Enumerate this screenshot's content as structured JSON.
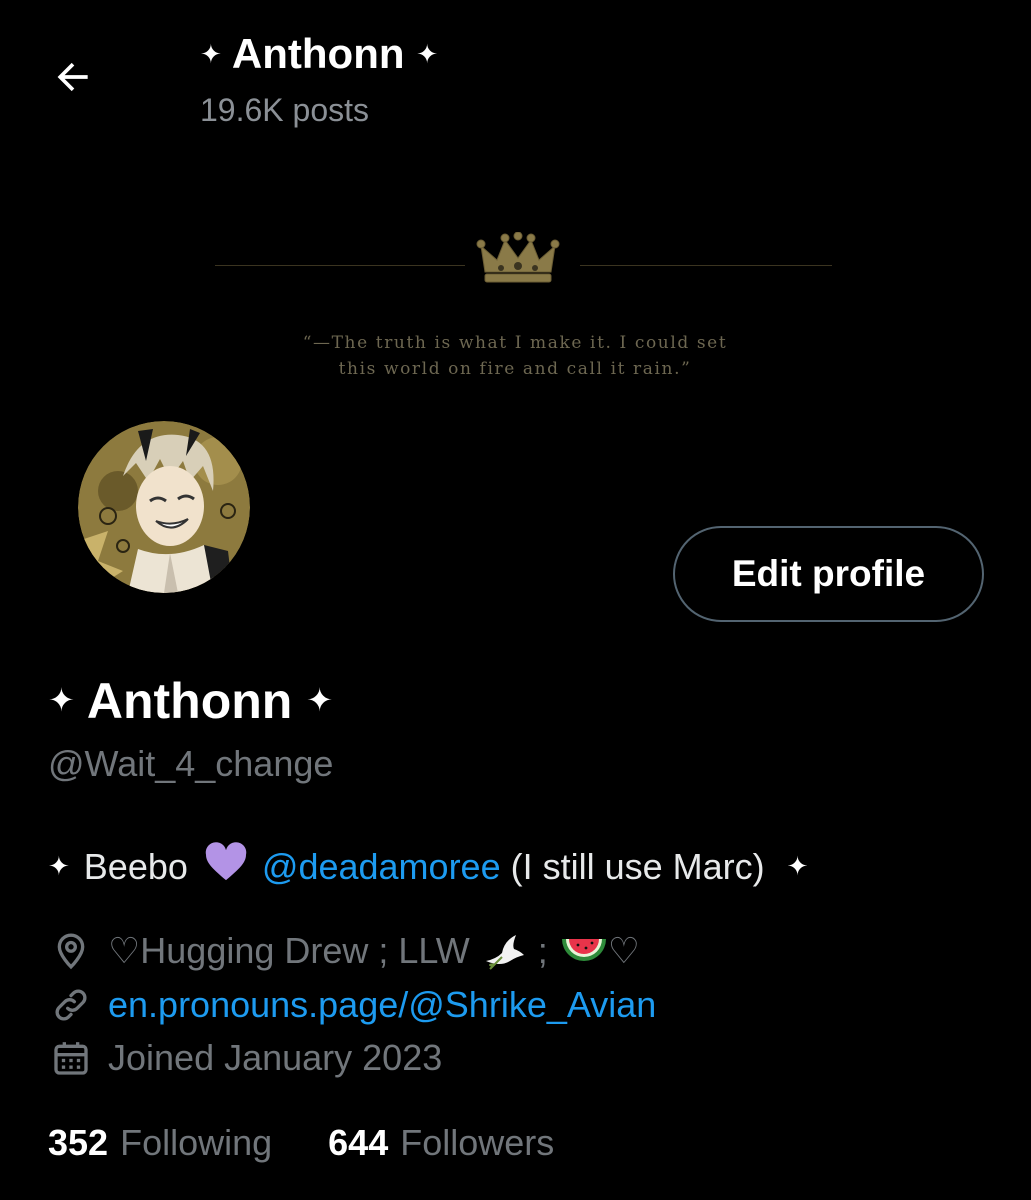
{
  "header": {
    "display_name": "Anthonn",
    "posts_count": "19.6K posts",
    "sparkle": "✦"
  },
  "banner": {
    "quote_line1": "“—The truth is what I make it. I could set",
    "quote_line2": "this world on fire and call it rain.”"
  },
  "actions": {
    "edit_profile_label": "Edit profile"
  },
  "profile": {
    "display_name": "Anthonn",
    "handle": "@Wait_4_change",
    "bio": {
      "text_before": "Beebo",
      "heart": "💜",
      "mention": "@deadamoree",
      "text_after": "(I still use Marc)"
    },
    "location": {
      "heart_left": "♡",
      "text": "Hugging Drew ; LLW",
      "dove": "🕊️",
      "separator": ";",
      "watermelon": "🍉",
      "heart_right": "♡"
    },
    "website": "en.pronouns.page/@Shrike_Avian",
    "joined": "Joined January 2023"
  },
  "stats": {
    "following_count": "352",
    "following_label": "Following",
    "followers_count": "644",
    "followers_label": "Followers"
  },
  "colors": {
    "background": "#000000",
    "text_primary": "#e7e9ea",
    "text_secondary": "#71767b",
    "link": "#1d9bf0",
    "border": "#536471",
    "banner_gold": "#6d6751"
  },
  "icons": {
    "back": "arrow-left-icon",
    "location": "location-pin-icon",
    "link": "link-icon",
    "calendar": "calendar-icon",
    "crown": "crown-icon"
  }
}
